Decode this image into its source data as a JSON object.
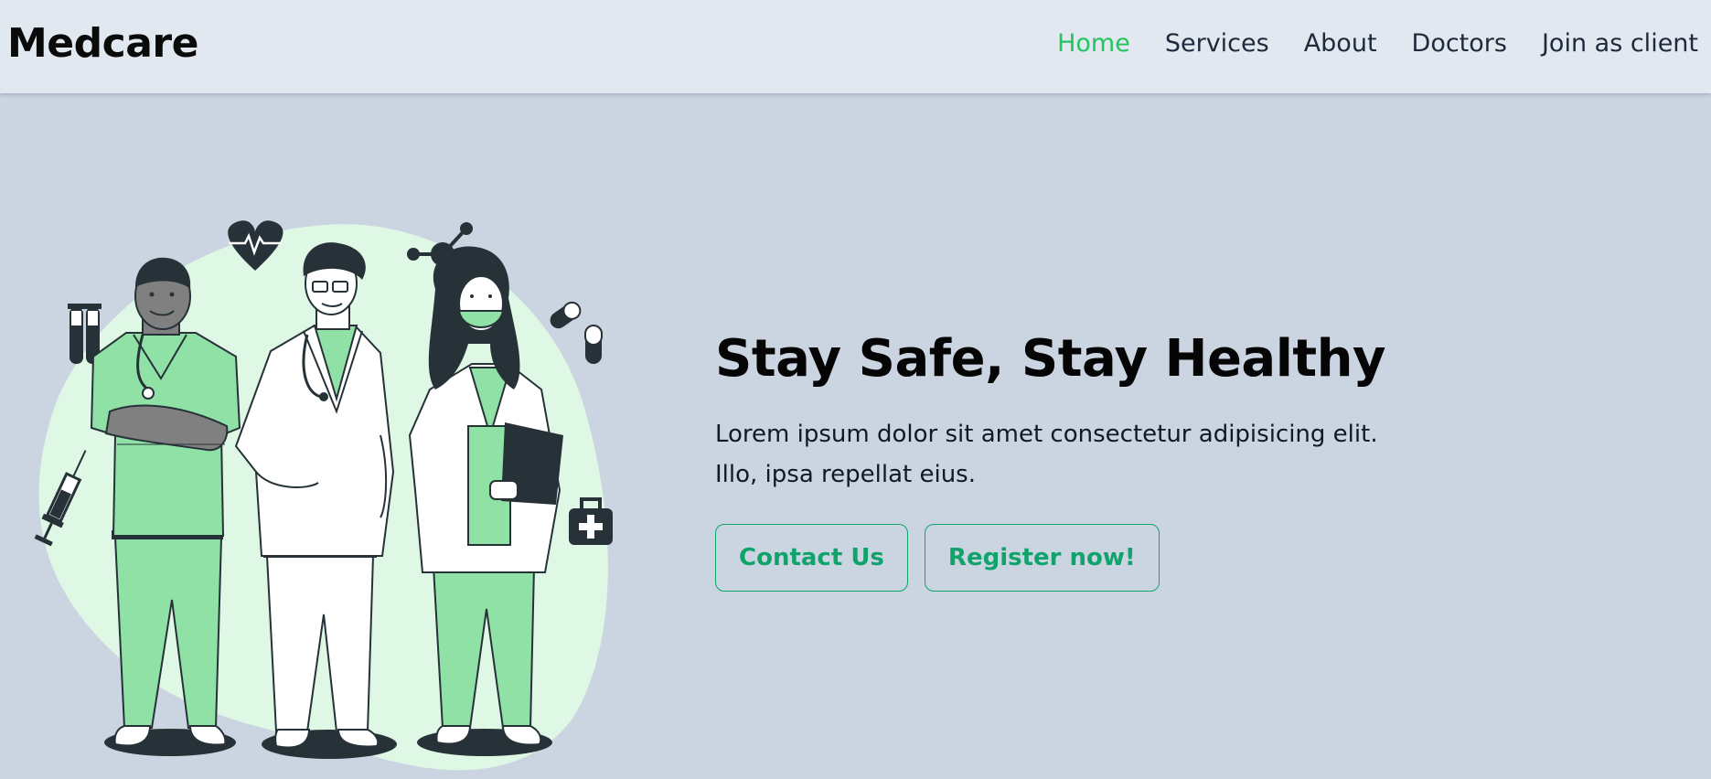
{
  "brand": {
    "name": "Medcare"
  },
  "nav": {
    "items": [
      {
        "label": "Home",
        "active": true
      },
      {
        "label": "Services",
        "active": false
      },
      {
        "label": "About",
        "active": false
      },
      {
        "label": "Doctors",
        "active": false
      },
      {
        "label": "Join as client",
        "active": false
      }
    ]
  },
  "hero": {
    "title": "Stay Safe, Stay Healthy",
    "description_line1": "Lorem ipsum dolor sit amet consectetur adipisicing elit.",
    "description_line2": "Illo, ipsa repellat eius.",
    "buttons": {
      "contact_label": "Contact Us",
      "register_label": "Register now!"
    }
  },
  "illustration": {
    "icons": [
      "heart-rate-icon",
      "molecule-icon",
      "test-tubes-icon",
      "pill-icon",
      "syringe-icon",
      "first-aid-kit-icon"
    ]
  },
  "colors": {
    "accent": "#22c55e",
    "button": "#10a36c",
    "page_background": "#cbd5e1",
    "navbar_background": "#e2e8f0",
    "scrubs": "#8fe1a6",
    "blob": "#dff7e5",
    "dark": "#263238"
  }
}
